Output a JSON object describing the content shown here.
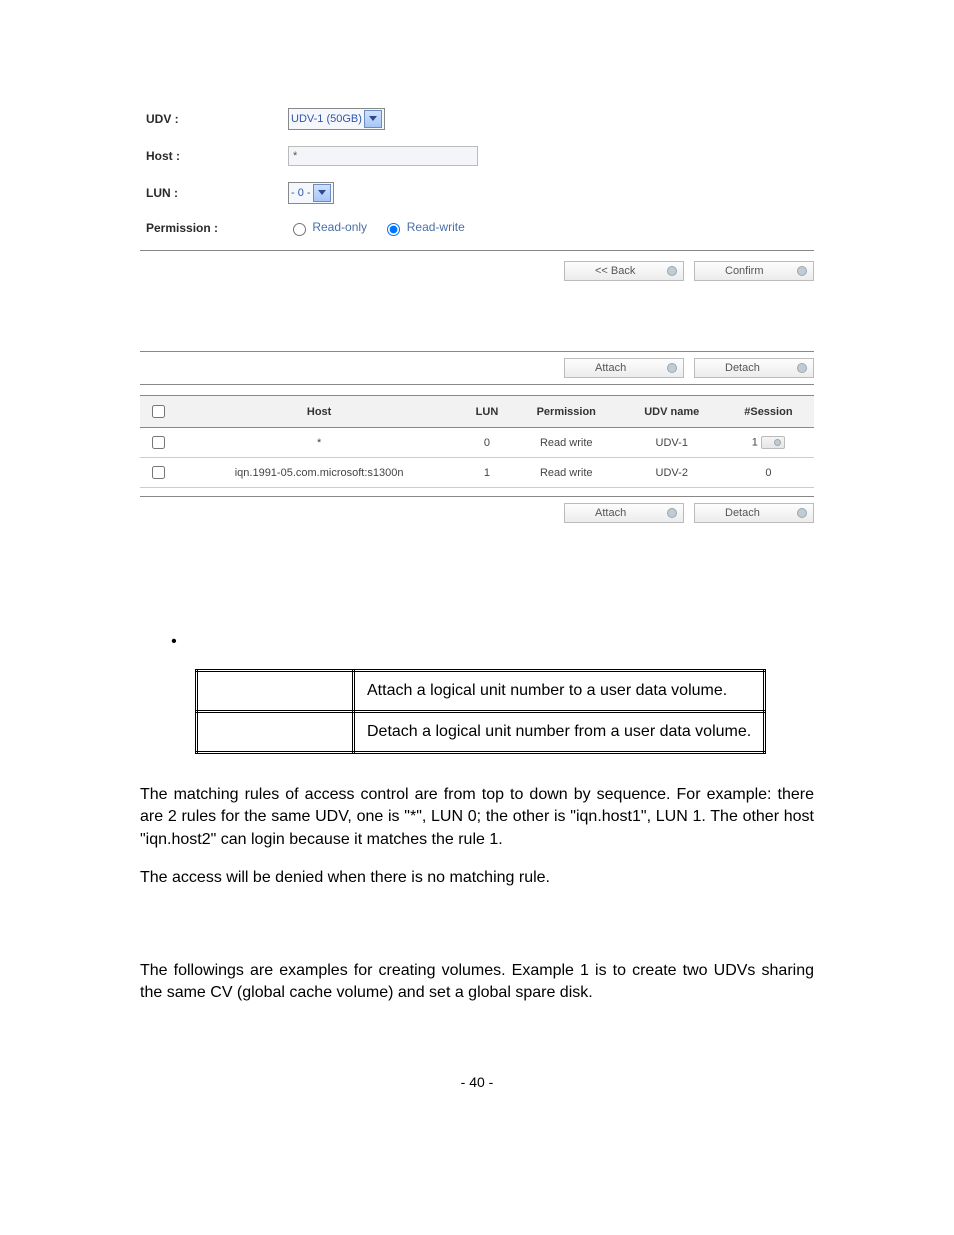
{
  "form": {
    "labels": {
      "udv": "UDV :",
      "host": "Host :",
      "lun": "LUN :",
      "permission": "Permission :"
    },
    "udv_value": "UDV-1 (50GB)",
    "host_value": "*",
    "lun_value": "- 0 -",
    "perm_read_only": "Read-only",
    "perm_read_write": "Read-write"
  },
  "buttons": {
    "back": "<< Back",
    "confirm": "Confirm",
    "attach": "Attach",
    "detach": "Detach"
  },
  "host_table": {
    "headers": {
      "host": "Host",
      "lun": "LUN",
      "permission": "Permission",
      "udv_name": "UDV name",
      "session": "#Session"
    },
    "rows": [
      {
        "host": "*",
        "lun": "0",
        "permission": "Read write",
        "udv_name": "UDV-1",
        "session": "1"
      },
      {
        "host": "iqn.1991-05.com.microsoft:s1300n",
        "lun": "1",
        "permission": "Read write",
        "udv_name": "UDV-2",
        "session": "0"
      }
    ]
  },
  "desc_table": {
    "row1": "Attach a logical unit number to a user data volume.",
    "row2": "Detach a logical unit number from a user data volume."
  },
  "paragraphs": {
    "p1": "The matching rules of access control are from top to down by sequence. For example: there are 2 rules for the same UDV, one is \"*\", LUN 0; the other is \"iqn.host1\", LUN 1. The other host \"iqn.host2\" can login because it matches the rule 1.",
    "p2": "The access will be denied when there is no matching rule.",
    "p3": "The followings are examples for creating volumes. Example 1 is to create two UDVs sharing the same CV (global cache volume) and set a global spare disk."
  },
  "page_number": "- 40 -"
}
